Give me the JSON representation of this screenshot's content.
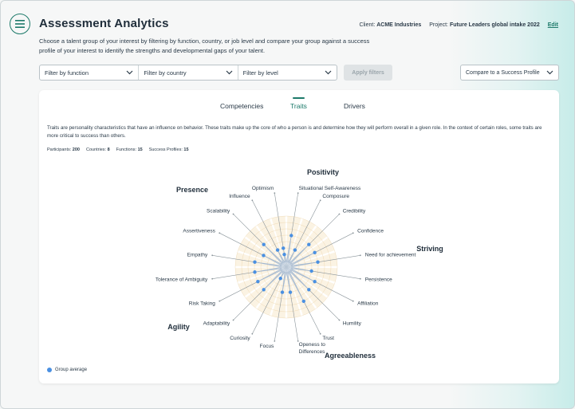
{
  "header": {
    "title": "Assessment Analytics",
    "client_label": "Client:",
    "client_value": "ACME Industries",
    "project_label": "Project:",
    "project_value": "Future Leaders global intake 2022",
    "edit_label": "Edit",
    "description": "Choose a talent group of your interest by filtering by function, country, or job level and compare your group against a success profile of your interest to identify the strengths and developmental gaps of your talent."
  },
  "filters": {
    "function_label": "Filter by function",
    "country_label": "Filter by country",
    "level_label": "Filter by level",
    "apply_label": "Apply filters",
    "compare_label": "Compare to a Success Profile"
  },
  "tabs": [
    "Competencies",
    "Traits",
    "Drivers"
  ],
  "card": {
    "description": "Traits are personality characteristics that have an influence on behavior. These traits make up the core of who a person is and determine how they will perform overall in a given role. In the context of certain roles, some traits are more critical to success than others.",
    "stats": {
      "participants_label": "Participants:",
      "participants_value": "200",
      "countries_label": "Countries:",
      "countries_value": "8",
      "functions_label": "Functions:",
      "functions_value": "15",
      "profiles_label": "Success Profiles:",
      "profiles_value": "15"
    },
    "legend_label": "Group average"
  },
  "colors": {
    "accent": "#1d7a6a",
    "point": "#4a90e2",
    "fill": "#c9d8ea",
    "ring_fill": "#fbf3e3",
    "ring_line": "#e6c58f"
  },
  "chart_data": {
    "type": "radar",
    "categories": [
      {
        "name": "Positivity",
        "traits": [
          "Optimism",
          "Situational Self-Awareness",
          "Composure",
          "Credibility",
          "Confidence"
        ]
      },
      {
        "name": "Striving",
        "traits": [
          "Need for achievement",
          "Persistence",
          "Affiliation"
        ]
      },
      {
        "name": "Agreeableness",
        "traits": [
          "Humility",
          "Trust",
          "Openess to Differences"
        ]
      },
      {
        "name": "Agility",
        "traits": [
          "Focus",
          "Curiosity",
          "Adaptability",
          "Risk Taking",
          "Tolerance of Ambiguity"
        ]
      },
      {
        "name": "Presence",
        "traits": [
          "Empathy",
          "Assertiveness",
          "Scalability",
          "Influence"
        ]
      }
    ],
    "series": [
      {
        "name": "Group average",
        "values": [
          3,
          5,
          3,
          5,
          5,
          5,
          4,
          5,
          5,
          6,
          4,
          4,
          2,
          5,
          5,
          5,
          5,
          4,
          5,
          3,
          2
        ]
      }
    ],
    "rlim": [
      0,
      10
    ]
  }
}
